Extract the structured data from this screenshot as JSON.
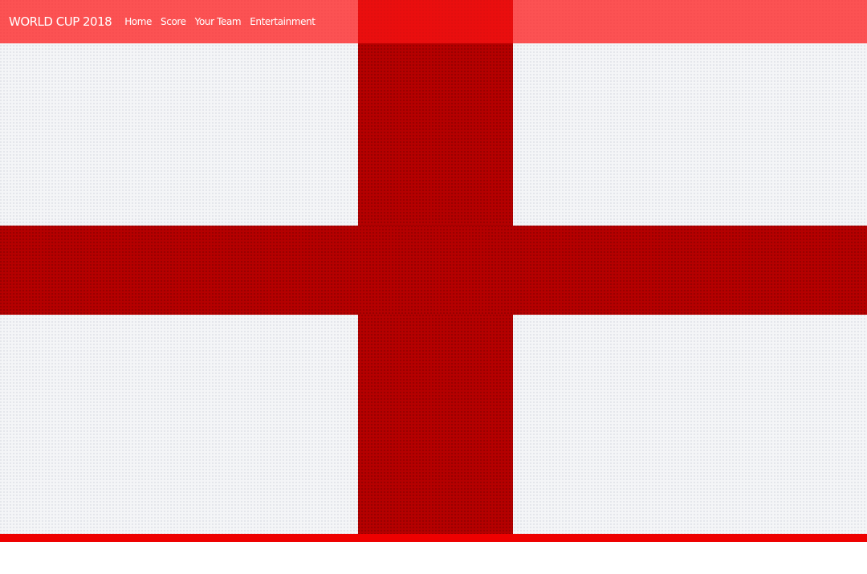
{
  "navbar": {
    "brand": "WORLD CUP 2018",
    "links": [
      {
        "label": "Home"
      },
      {
        "label": "Score"
      },
      {
        "label": "Your Team"
      },
      {
        "label": "Entertainment"
      }
    ]
  },
  "colors": {
    "navbar_bg": "#ff1414",
    "cross_red": "#b50000",
    "flag_white": "#f4f5f7",
    "bottom_stripe": "#ee0000"
  }
}
